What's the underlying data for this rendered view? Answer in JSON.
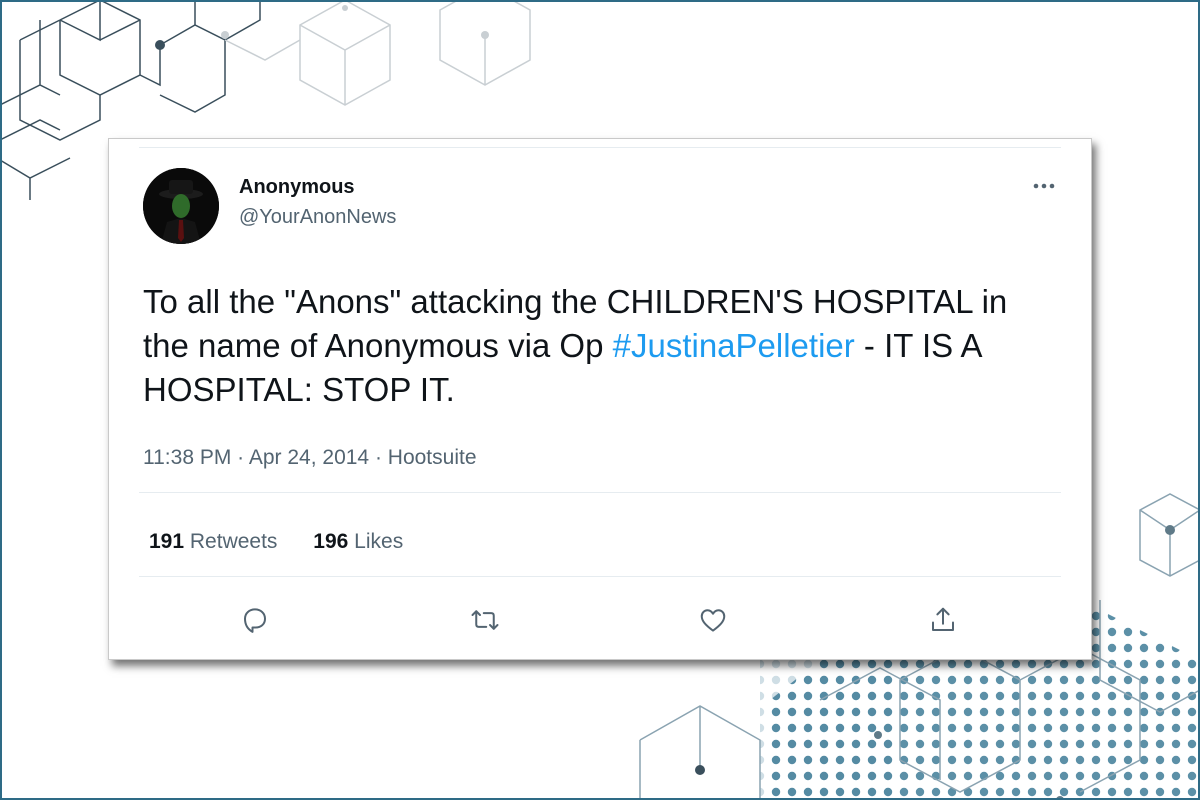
{
  "tweet": {
    "author_name": "Anonymous",
    "author_handle": "@YourAnonNews",
    "text_before": "To all the \"Anons\" attacking the CHILDREN'S HOSPITAL in the name of Anonymous via Op ",
    "hashtag": "#JustinaPelletier",
    "text_after": " - IT IS A HOSPITAL: STOP IT.",
    "time": "11:38 PM",
    "date": "Apr 24, 2014",
    "source": "Hootsuite",
    "separator": " · ",
    "retweets_count": "191",
    "retweets_label": "Retweets",
    "likes_count": "196",
    "likes_label": "Likes"
  },
  "icons": {
    "more": "more-icon",
    "reply": "reply-icon",
    "retweet": "retweet-icon",
    "like": "heart-icon",
    "share": "share-icon"
  },
  "colors": {
    "hashtag": "#1d9bf0",
    "secondary_text": "#536471",
    "primary_text": "#0f1419",
    "frame": "#2e6b86"
  }
}
